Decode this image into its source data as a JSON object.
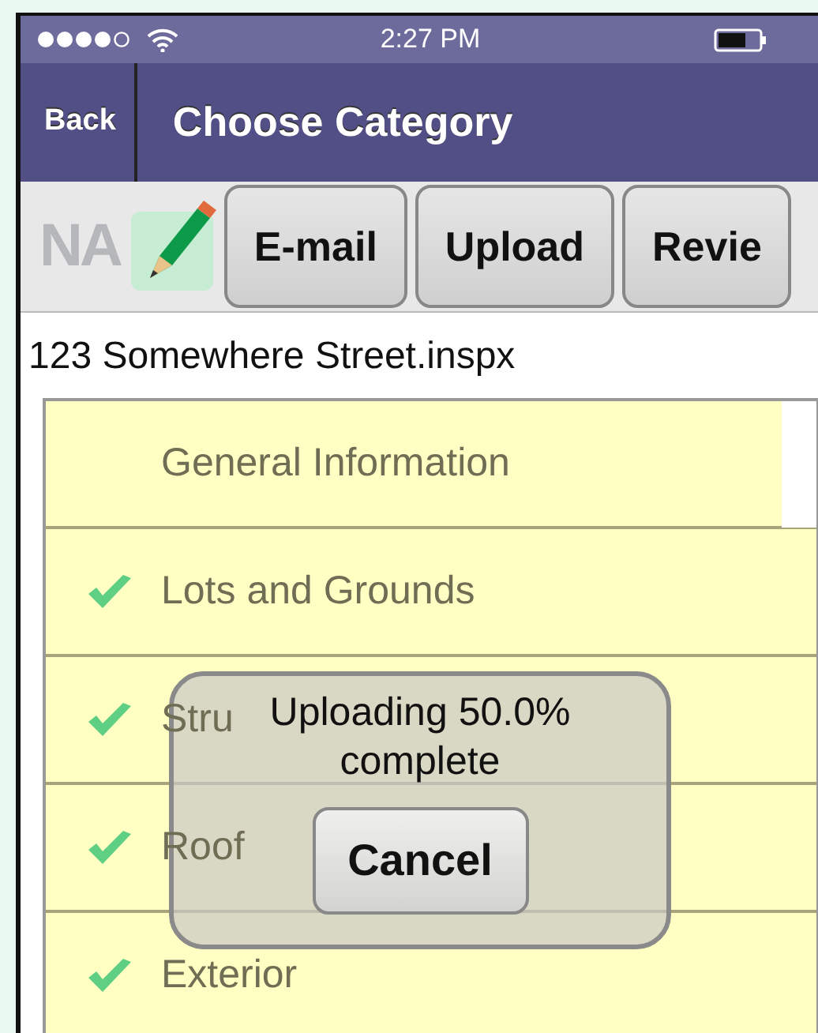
{
  "status_bar": {
    "time": "2:27 PM"
  },
  "nav_bar": {
    "back": "Back",
    "title": "Choose Category"
  },
  "toolbar": {
    "logo": "NA",
    "buttons": [
      "E-mail",
      "Upload",
      "Revie"
    ]
  },
  "file_name": "123 Somewhere Street.inspx",
  "categories": [
    {
      "label": "General Information",
      "checked": false
    },
    {
      "label": "Lots and Grounds",
      "checked": true
    },
    {
      "label": "Stru",
      "checked": true
    },
    {
      "label": "Roof",
      "checked": true
    },
    {
      "label": "Exterior",
      "checked": true
    }
  ],
  "upload_dialog": {
    "message": "Uploading 50.0% complete",
    "button": "Cancel"
  }
}
